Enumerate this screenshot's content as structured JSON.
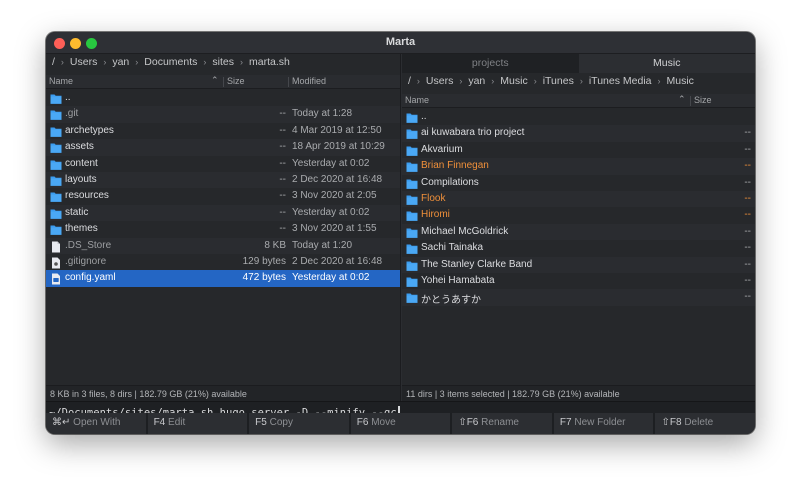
{
  "window": {
    "title": "Marta"
  },
  "left_pane": {
    "path": [
      "/",
      "Users",
      "yan",
      "Documents",
      "sites",
      "marta.sh"
    ],
    "columns": {
      "name": "Name",
      "size": "Size",
      "modified": "Modified"
    },
    "rows": [
      {
        "icon": "folder-icon",
        "name": "..",
        "size": "",
        "modified": "",
        "style": "normal"
      },
      {
        "icon": "folder-icon",
        "name": ".git",
        "size": "--",
        "modified": "Today at 1:28",
        "style": "dim"
      },
      {
        "icon": "folder-icon",
        "name": "archetypes",
        "size": "--",
        "modified": "4 Mar 2019 at 12:50",
        "style": "normal"
      },
      {
        "icon": "folder-icon",
        "name": "assets",
        "size": "--",
        "modified": "18 Apr 2019 at 10:29",
        "style": "normal"
      },
      {
        "icon": "folder-icon",
        "name": "content",
        "size": "--",
        "modified": "Yesterday at 0:02",
        "style": "normal"
      },
      {
        "icon": "folder-icon",
        "name": "layouts",
        "size": "--",
        "modified": "2 Dec 2020 at 16:48",
        "style": "normal"
      },
      {
        "icon": "folder-icon",
        "name": "resources",
        "size": "--",
        "modified": "3 Nov 2020 at 2:05",
        "style": "normal"
      },
      {
        "icon": "folder-icon",
        "name": "static",
        "size": "--",
        "modified": "Yesterday at 0:02",
        "style": "normal"
      },
      {
        "icon": "folder-icon",
        "name": "themes",
        "size": "--",
        "modified": "3 Nov 2020 at 1:55",
        "style": "normal"
      },
      {
        "icon": "file-icon",
        "name": ".DS_Store",
        "size": "8 KB",
        "modified": "Today at 1:20",
        "style": "dim"
      },
      {
        "icon": "gitignore-file-icon",
        "name": ".gitignore",
        "size": "129 bytes",
        "modified": "2 Dec 2020 at 16:48",
        "style": "dim"
      },
      {
        "icon": "yaml-file-icon",
        "name": "config.yaml",
        "size": "472 bytes",
        "modified": "Yesterday at 0:02",
        "style": "selected"
      }
    ],
    "status": "8 KB in 3 files, 8 dirs | 182.79 GB (21%) available"
  },
  "right_pane": {
    "tabs": [
      {
        "label": "projects",
        "active": false
      },
      {
        "label": "Music",
        "active": true
      }
    ],
    "path": [
      "/",
      "Users",
      "yan",
      "Music",
      "iTunes",
      "iTunes Media",
      "Music"
    ],
    "columns": {
      "name": "Name",
      "size": "Size"
    },
    "rows": [
      {
        "icon": "folder-icon",
        "name": "..",
        "size": "",
        "style": "normal"
      },
      {
        "icon": "folder-icon",
        "name": "ai kuwabara trio project",
        "size": "--",
        "style": "normal"
      },
      {
        "icon": "folder-icon",
        "name": "Akvarium",
        "size": "--",
        "style": "normal"
      },
      {
        "icon": "folder-icon",
        "name": "Brian Finnegan",
        "size": "--",
        "style": "marked"
      },
      {
        "icon": "folder-icon",
        "name": "Compilations",
        "size": "--",
        "style": "normal"
      },
      {
        "icon": "folder-icon",
        "name": "Flook",
        "size": "--",
        "style": "marked"
      },
      {
        "icon": "folder-icon",
        "name": "Hiromi",
        "size": "--",
        "style": "marked"
      },
      {
        "icon": "folder-icon",
        "name": "Michael McGoldrick",
        "size": "--",
        "style": "normal"
      },
      {
        "icon": "folder-icon",
        "name": "Sachi Tainaka",
        "size": "--",
        "style": "normal"
      },
      {
        "icon": "folder-icon",
        "name": "The Stanley Clarke Band",
        "size": "--",
        "style": "normal"
      },
      {
        "icon": "folder-icon",
        "name": "Yohei Hamabata",
        "size": "--",
        "style": "normal"
      },
      {
        "icon": "folder-icon",
        "name": "かとうあすか",
        "size": "--",
        "style": "normal"
      }
    ],
    "status": "11 dirs | 3 items selected | 182.79 GB (21%) available"
  },
  "terminal": {
    "command": "~/Documents/sites/marta.sh hugo server -D --minify --gc"
  },
  "function_keys": [
    {
      "key": "⌘↵",
      "label": "Open With"
    },
    {
      "key": "F4",
      "label": "Edit"
    },
    {
      "key": "F5",
      "label": "Copy"
    },
    {
      "key": "F6",
      "label": "Move"
    },
    {
      "key": "⇧F6",
      "label": "Rename"
    },
    {
      "key": "F7",
      "label": "New Folder"
    },
    {
      "key": "⇧F8",
      "label": "Delete"
    }
  ],
  "colors": {
    "accent": "#2466c4",
    "folder": "#3a9cf0",
    "marked": "#f0903a",
    "background": "#26282b"
  }
}
